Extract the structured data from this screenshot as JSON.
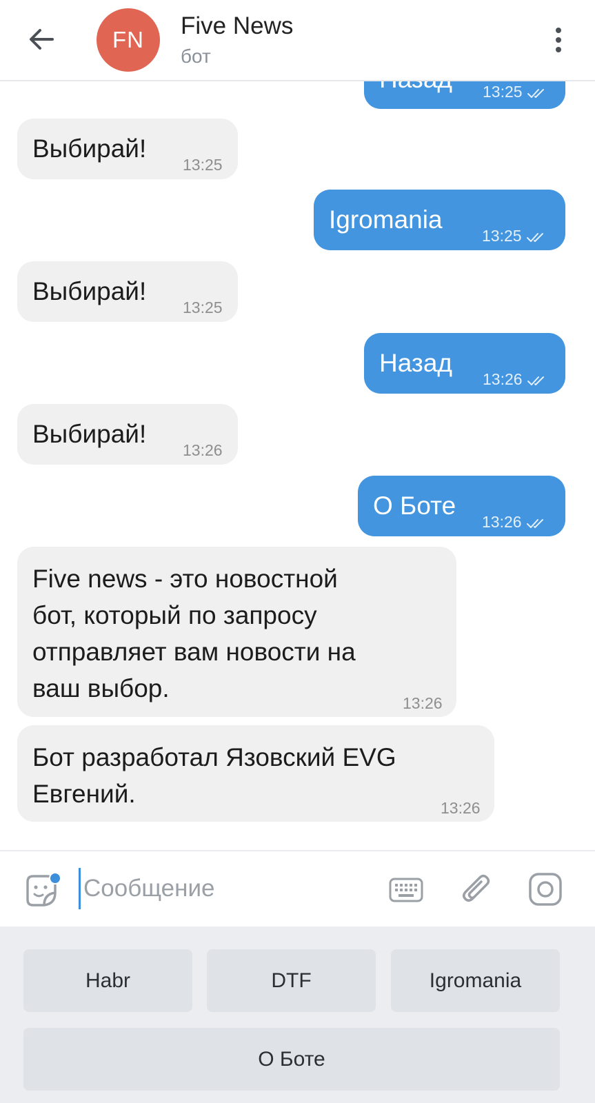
{
  "header": {
    "avatar_initials": "FN",
    "avatar_color": "#e06552",
    "title": "Five News",
    "subtitle": "бот",
    "back_icon": "arrow-left-icon",
    "menu_icon": "more-vertical-icon"
  },
  "messages": [
    {
      "direction": "out",
      "text": "Назад",
      "time": "13:25",
      "status": "read"
    },
    {
      "direction": "in",
      "text": "Выбирай!",
      "time": "13:25"
    },
    {
      "direction": "out",
      "text": "Igromania",
      "time": "13:25",
      "status": "read"
    },
    {
      "direction": "in",
      "text": "Выбирай!",
      "time": "13:25"
    },
    {
      "direction": "out",
      "text": "Назад",
      "time": "13:26",
      "status": "read"
    },
    {
      "direction": "in",
      "text": "Выбирай!",
      "time": "13:26"
    },
    {
      "direction": "out",
      "text": "О Боте",
      "time": "13:26",
      "status": "read"
    },
    {
      "direction": "in",
      "lines": [
        "Five news - это новостной",
        "бот, который по запросу",
        "отправляет вам новости на",
        "ваш выбор."
      ],
      "time": "13:26"
    },
    {
      "direction": "in",
      "lines": [
        "Бот разработал Язовский EVG",
        "Евгений."
      ],
      "time": "13:26"
    }
  ],
  "composer": {
    "placeholder": "Сообщение",
    "value": "",
    "icons": [
      "sticker-icon",
      "keyboard-icon",
      "paperclip-icon",
      "camera-icon"
    ]
  },
  "bot_keyboard": {
    "row1": [
      "Habr",
      "DTF",
      "Igromania"
    ],
    "row2": [
      "О Боте"
    ]
  },
  "colors": {
    "outgoing_bubble": "#4395df",
    "incoming_bubble": "#f0f0f0",
    "accent": "#3d8edb"
  }
}
